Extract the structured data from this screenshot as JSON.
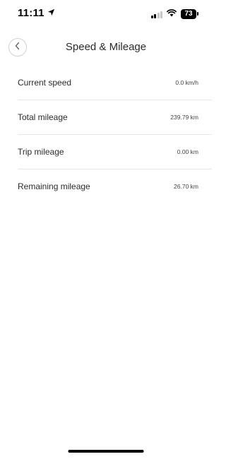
{
  "status_bar": {
    "time": "11:11",
    "battery": "73"
  },
  "header": {
    "title": "Speed & Mileage"
  },
  "rows": [
    {
      "label": "Current speed",
      "value": "0.0 km/h"
    },
    {
      "label": "Total mileage",
      "value": "239.79 km"
    },
    {
      "label": "Trip mileage",
      "value": "0.00 km"
    },
    {
      "label": "Remaining mileage",
      "value": "26.70 km"
    }
  ],
  "icons": {
    "back": "chevron-left-icon",
    "location": "location-arrow-icon",
    "signal": "cellular-signal-icon",
    "wifi": "wifi-icon"
  }
}
